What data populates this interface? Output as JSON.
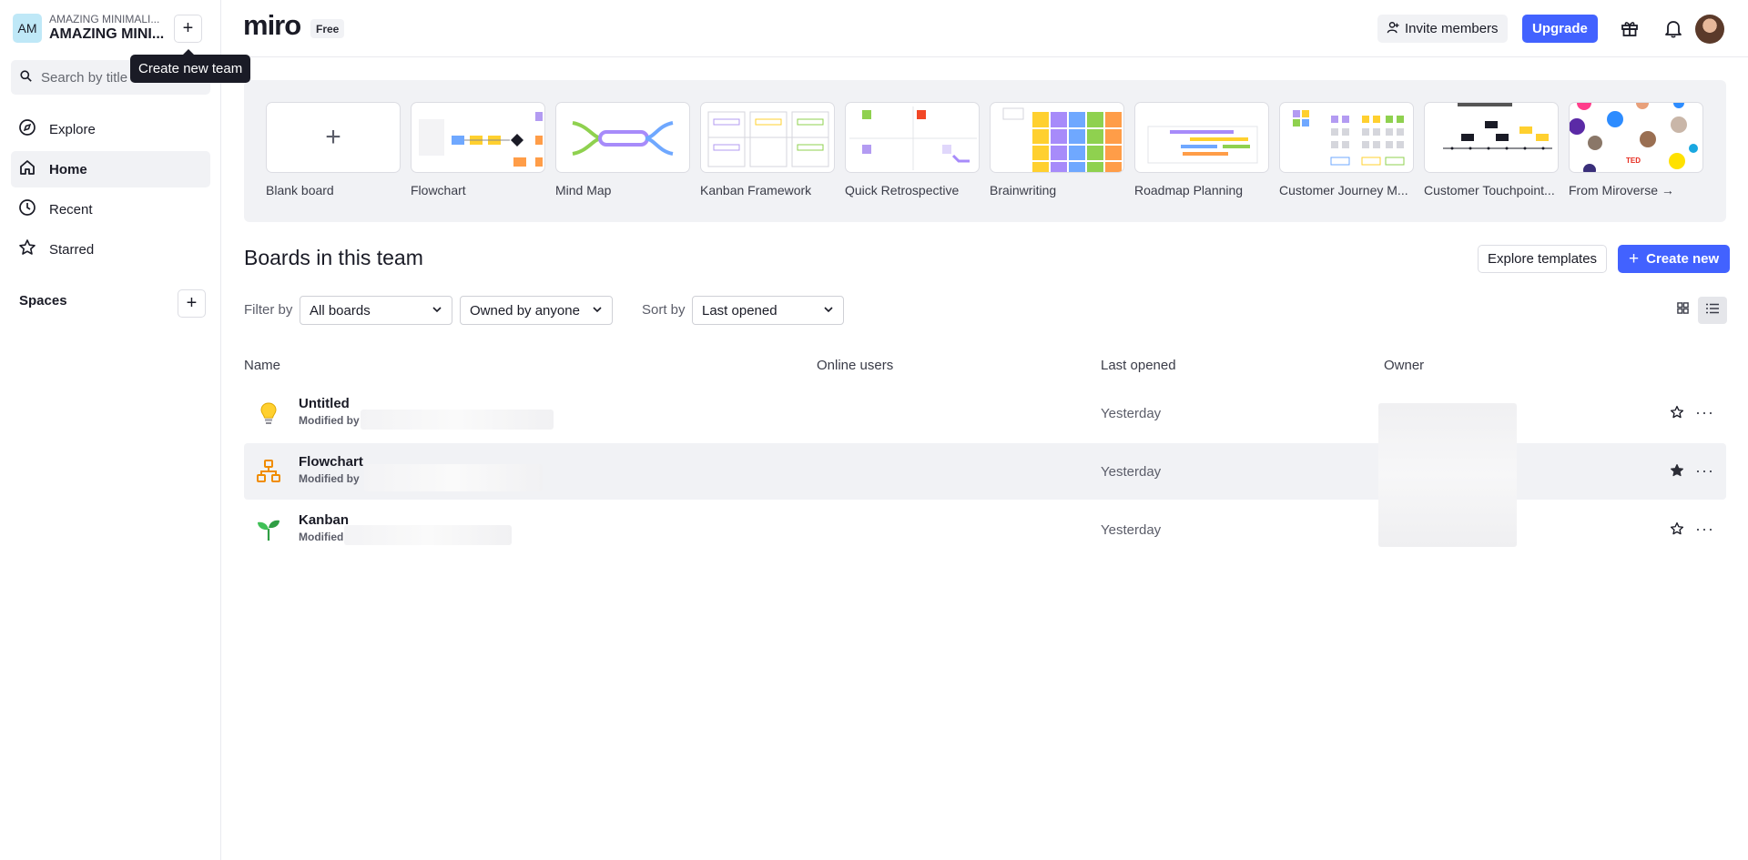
{
  "sidebar": {
    "team_avatar": "AM",
    "team_small": "AMAZING MINIMALI...",
    "team_big": "AMAZING MINI...",
    "add_team_tooltip": "Create new team",
    "search_placeholder": "Search by title o",
    "nav": [
      {
        "label": "Explore",
        "icon": "compass-icon"
      },
      {
        "label": "Home",
        "icon": "home-icon"
      },
      {
        "label": "Recent",
        "icon": "clock-icon"
      },
      {
        "label": "Starred",
        "icon": "star-icon"
      }
    ],
    "spaces_label": "Spaces"
  },
  "topbar": {
    "logo": "miro",
    "plan": "Free",
    "invite_label": "Invite members",
    "upgrade_label": "Upgrade"
  },
  "templates": [
    {
      "label": "Blank board"
    },
    {
      "label": "Flowchart"
    },
    {
      "label": "Mind Map"
    },
    {
      "label": "Kanban Framework"
    },
    {
      "label": "Quick Retrospective"
    },
    {
      "label": "Brainwriting"
    },
    {
      "label": "Roadmap Planning"
    },
    {
      "label": "Customer Journey M..."
    },
    {
      "label": "Customer Touchpoint..."
    },
    {
      "label": "From Miroverse →"
    }
  ],
  "boards": {
    "title": "Boards in this team",
    "explore_label": "Explore templates",
    "create_label": "Create new",
    "filter_label": "Filter by",
    "filter_value": "All boards",
    "owner_value": "Owned by anyone",
    "sort_label": "Sort by",
    "sort_value": "Last opened",
    "columns": {
      "name": "Name",
      "online": "Online users",
      "last_opened": "Last opened",
      "owner": "Owner"
    },
    "rows": [
      {
        "title": "Untitled",
        "sub": "Modified by",
        "date": "Yesterday",
        "starred": false,
        "icon": "lightbulb-icon"
      },
      {
        "title": "Flowchart",
        "sub": "Modified by",
        "date": "Yesterday",
        "starred": true,
        "icon": "flowchart-icon"
      },
      {
        "title": "Kanban",
        "sub": "Modified",
        "date": "Yesterday",
        "starred": false,
        "icon": "sprout-icon"
      }
    ]
  },
  "colors": {
    "accent": "#4262ff",
    "text": "#1a1b26",
    "muted": "#5b5d69",
    "panel": "#f1f2f5"
  }
}
